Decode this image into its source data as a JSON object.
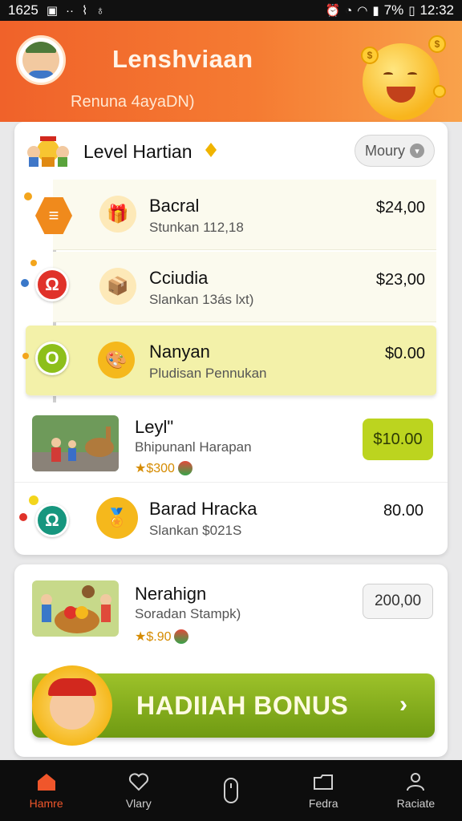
{
  "status_bar": {
    "time_left": "1625",
    "battery": "7%",
    "time_right": "12:32"
  },
  "header": {
    "title": "Lenshviaan",
    "subtitle": "Renuna 4ayaDN)"
  },
  "level": {
    "title": "Level Hartian",
    "money_button": "Moury"
  },
  "rows": [
    {
      "title": "Bacral",
      "subtitle": "Stunkan 112,18",
      "amount": "$24,00",
      "badge": "≡",
      "badge_color": "#f08a1c",
      "thumb": "🎁"
    },
    {
      "title": "Cciudia",
      "subtitle": "Slankan 13ás lxt)",
      "amount": "$23,00",
      "badge": "Ω",
      "badge_color": "#e0322a",
      "thumb": "📦"
    },
    {
      "title": "Nanyan",
      "subtitle": "Pludisan Pennukan",
      "amount": "$0.00",
      "badge": "O",
      "badge_color": "#8dbf1a",
      "thumb": "🎨"
    },
    {
      "title": "Leyl\"",
      "subtitle": "Bhipunanl Harapan",
      "amount": "$10.00",
      "stars": "★$300"
    },
    {
      "title": "Barad Hracka",
      "subtitle": "Slankan $021S",
      "amount": "80.00",
      "badge": "Ω",
      "badge_color": "#16967e",
      "thumb": "🏅"
    }
  ],
  "bottom_card": {
    "title": "Nerahign",
    "subtitle": "Soradan Stampk)",
    "stars": "★$.90",
    "amount": "200,00",
    "bonus_button": "HADIIAH BONUS"
  },
  "nav": [
    {
      "label": "Hamre",
      "icon": "home-icon",
      "active": true
    },
    {
      "label": "Vlary",
      "icon": "heart-icon",
      "active": false
    },
    {
      "label": "",
      "icon": "capsule-icon",
      "active": false
    },
    {
      "label": "Fedra",
      "icon": "folder-icon",
      "active": false
    },
    {
      "label": "Raciate",
      "icon": "profile-icon",
      "active": false
    }
  ],
  "colors": {
    "header_orange": "#f0622a",
    "accent_green": "#bcd41f",
    "highlight_yellow": "#f3f1a9",
    "nav_active": "#f0562b"
  }
}
